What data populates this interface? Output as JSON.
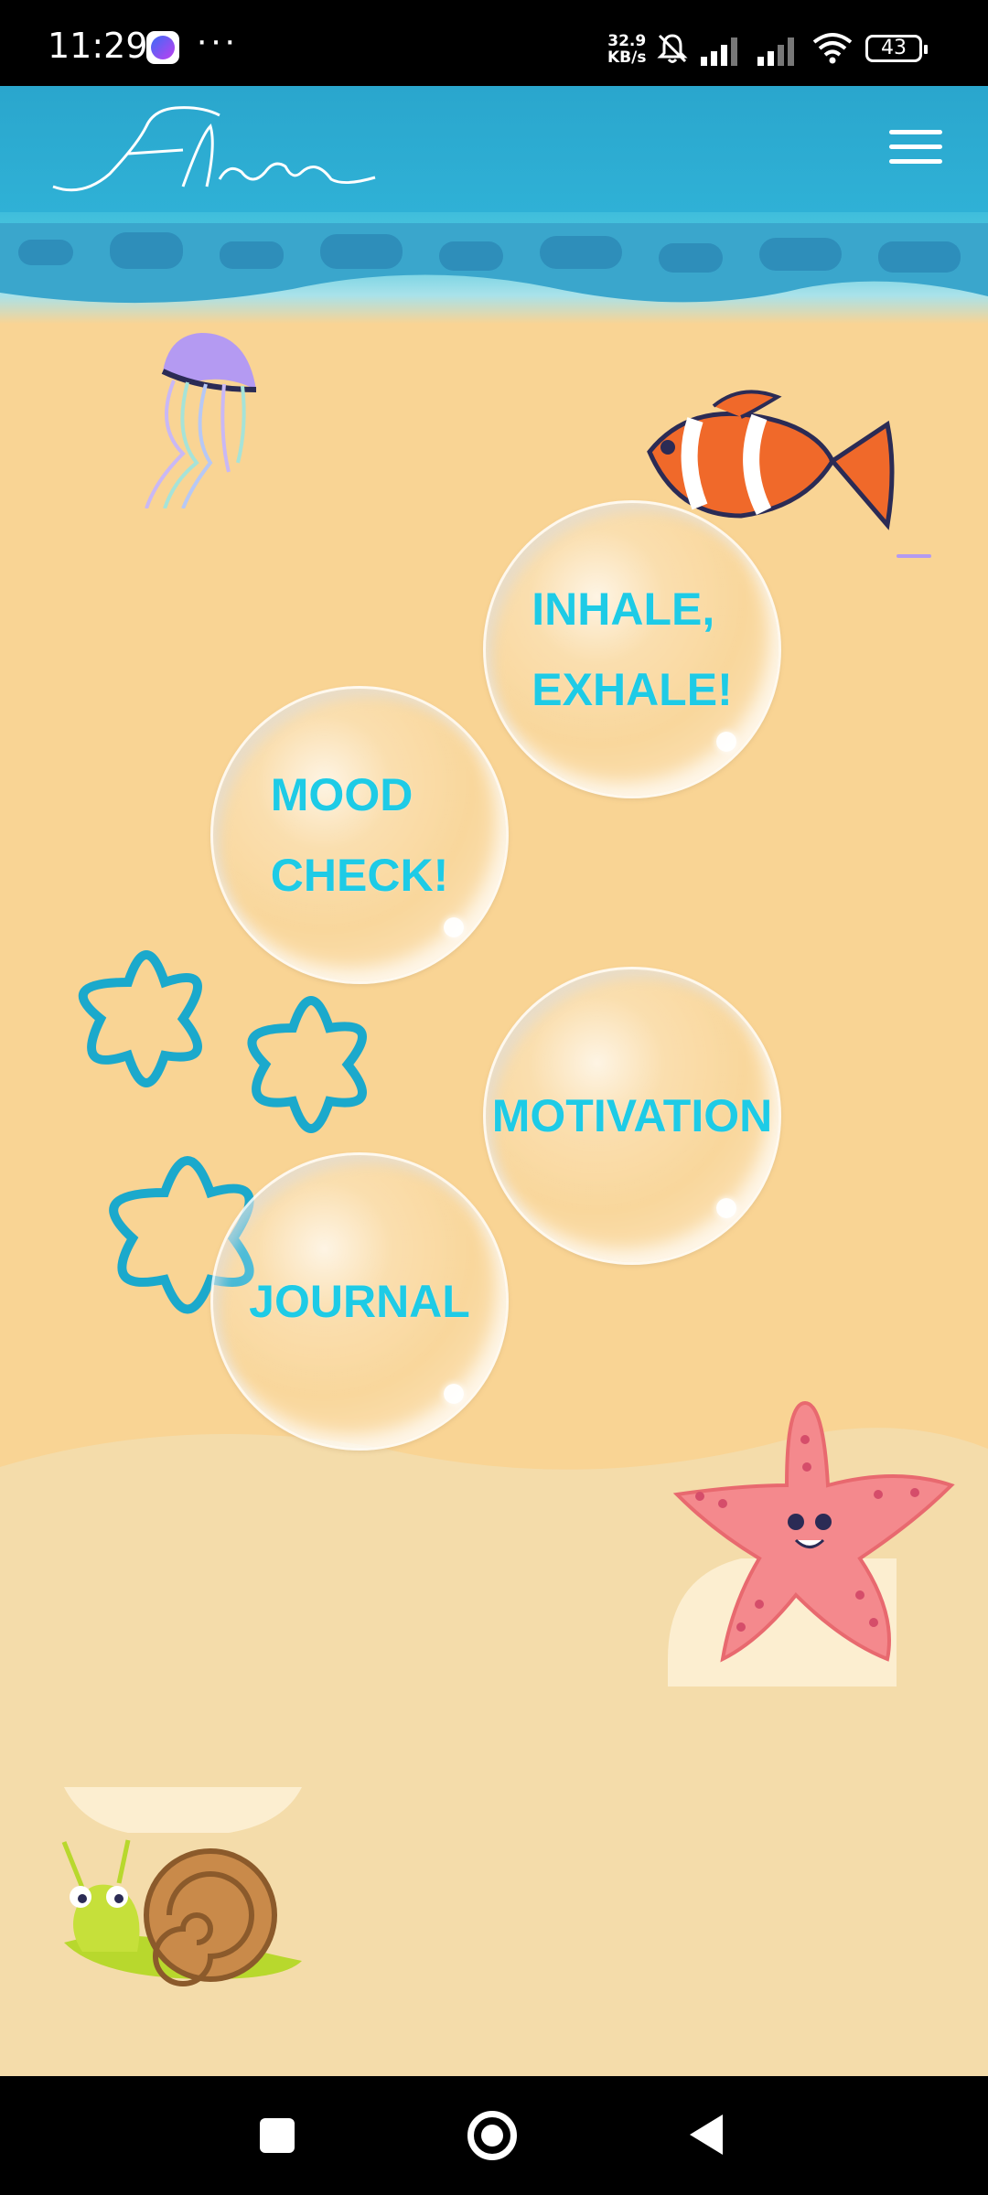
{
  "status_bar": {
    "time": "11:29",
    "dots": "···",
    "net_speed_value": "32.9",
    "net_speed_unit": "KB/s",
    "battery": "43"
  },
  "header": {
    "logo_text": "Elon",
    "menu_icon": "hamburger-icon"
  },
  "bubbles": [
    {
      "label": "INHALE,\nEXHALE!"
    },
    {
      "label": "MOOD\nCHECK!"
    },
    {
      "label": "MOTIVATION"
    },
    {
      "label": "JOURNAL"
    }
  ],
  "colors": {
    "header": "#2fb1d6",
    "sand": "#f9d494",
    "bubble_text": "#1ecbe6"
  },
  "nav_bar": {
    "recent_icon": "square-icon",
    "home_icon": "circle-icon",
    "back_icon": "triangle-back-icon"
  }
}
